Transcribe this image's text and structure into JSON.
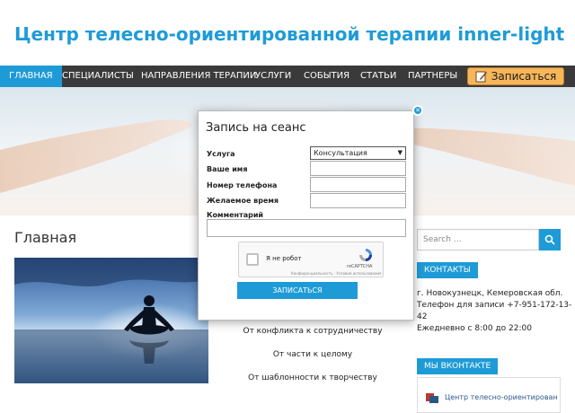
{
  "site": {
    "title": "Центр телесно-ориентированной терапии inner-light"
  },
  "nav": {
    "items": [
      "Главная",
      "Специалисты",
      "Направления терапии",
      "Услуги",
      "События",
      "Статьи",
      "Партнеры"
    ],
    "book_label": "Записаться"
  },
  "main": {
    "heading": "Главная",
    "topics": [
      "От конфликта к сотрудничеству",
      "От части к целому",
      "От шаблонности к творчеству"
    ]
  },
  "sidebar": {
    "search_placeholder": "Search …",
    "contacts_title": "Контакты",
    "address": "г. Новокузнецк, Кемеровская обл.",
    "phone_line1": "Телефон для записи +7-951-172-13-",
    "phone_line2": "42",
    "hours": "Ежедневно с 8:00 до 22:00",
    "vk_title": "Мы ВКонтакте",
    "vk_name": "Центр телесно-ориентированной терапии inner-light"
  },
  "modal": {
    "title": "Запись на сеанс",
    "fields": {
      "service_label": "Услуга",
      "service_value": "Консультация",
      "name_label": "Ваше имя",
      "name_value": "",
      "phone_label": "Номер телефона",
      "phone_value": "",
      "time_label": "Желаемое время",
      "time_value": "",
      "comment_label": "Комментарий",
      "comment_value": ""
    },
    "captcha": {
      "label": "Я не робот",
      "brand": "reCAPTCHA",
      "footer": "Конфиденциальность - Условия использования"
    },
    "submit_label": "Записаться"
  },
  "colors": {
    "accent": "#1e9bd7",
    "nav_bg": "#3a3a3a",
    "book_button": "#f7b65a"
  }
}
